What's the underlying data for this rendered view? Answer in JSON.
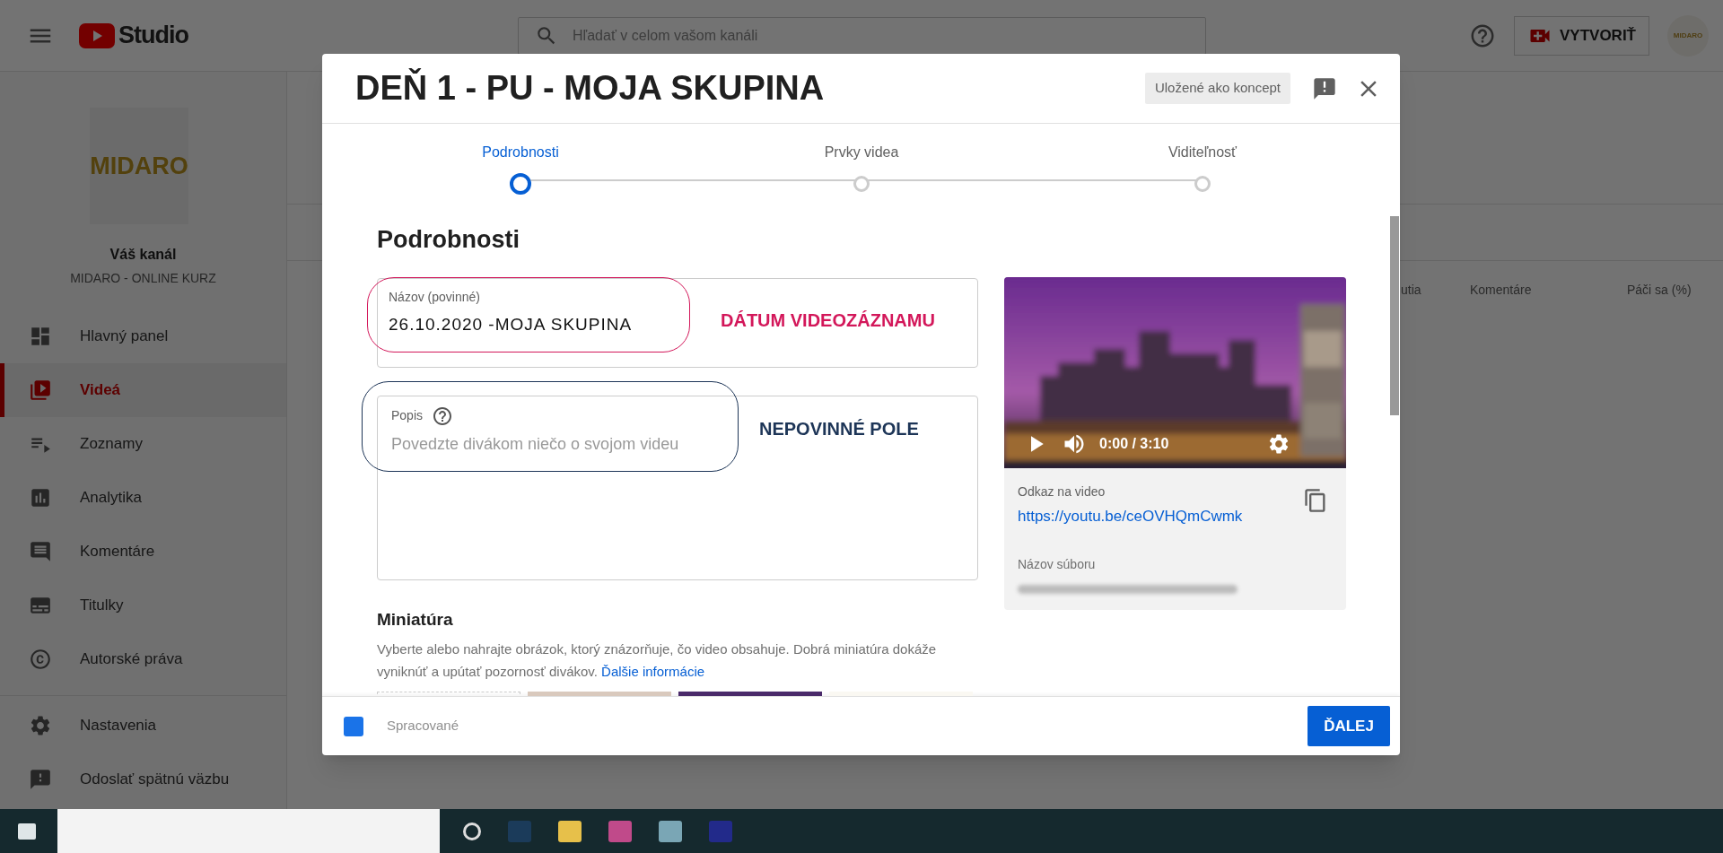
{
  "topbar": {
    "logo_text": "Studio",
    "search": {
      "placeholder": "Hľadať v celom vašom kanáli"
    },
    "create_button": "VYTVORIŤ",
    "avatar_text": "MIDARO"
  },
  "sidebar": {
    "channel_logo_text": "MIDARO",
    "channel_label": "Váš kanál",
    "channel_name": "MIDARO - ONLINE KURZ",
    "items": [
      {
        "label": "Hlavný panel",
        "kind": "dashboard",
        "selected": false
      },
      {
        "label": "Videá",
        "kind": "videos",
        "selected": true
      },
      {
        "label": "Zoznamy",
        "kind": "playlists",
        "selected": false
      },
      {
        "label": "Analytika",
        "kind": "analytics",
        "selected": false
      },
      {
        "label": "Komentáre",
        "kind": "comments",
        "selected": false
      },
      {
        "label": "Titulky",
        "kind": "subtitles",
        "selected": false
      },
      {
        "label": "Autorské práva",
        "kind": "copyright",
        "selected": false
      }
    ],
    "footer_items": [
      {
        "label": "Nastavenia",
        "kind": "settings"
      },
      {
        "label": "Odoslať spätnú väzbu",
        "kind": "feedback"
      }
    ]
  },
  "table": {
    "columns": [
      "utia",
      "Komentáre",
      "Páči sa (%)"
    ]
  },
  "dialog": {
    "title": "DEŇ 1 - PU - MOJA SKUPINA",
    "draft_badge": "Uložené ako koncept",
    "steps": [
      {
        "label": "Podrobnosti",
        "selected": true
      },
      {
        "label": "Prvky videa",
        "selected": false
      },
      {
        "label": "Viditeľnosť",
        "selected": false
      }
    ],
    "section_title": "Podrobnosti",
    "title_field": {
      "label": "Názov (povinné)",
      "value": "26.10.2020 -MOJA SKUPINA"
    },
    "description_field": {
      "label": "Popis",
      "placeholder": "Povedzte divákom niečo o svojom videu"
    },
    "annotations": [
      {
        "label": "DÁTUM VIDEOZÁZNAMU",
        "color": "#d3175a"
      },
      {
        "label": "NEPOVINNÉ POLE",
        "color": "#1d3557"
      }
    ],
    "video": {
      "time": "0:00 / 3:10",
      "link_label": "Odkaz na video",
      "link": "https://youtu.be/ceOVHQmCwmk",
      "filename_label": "Názov súboru"
    },
    "thumbnail": {
      "title": "Miniatúra",
      "description": "Vyberte alebo nahrajte obrázok, ktorý znázorňuje, čo video obsahuje. Dobrá miniatúra dokáže vyniknúť a upútať pozornosť divákov.",
      "link": "Ďalšie informácie"
    },
    "footer": {
      "status": "Spracované",
      "next_button": "ĎALEJ"
    }
  }
}
